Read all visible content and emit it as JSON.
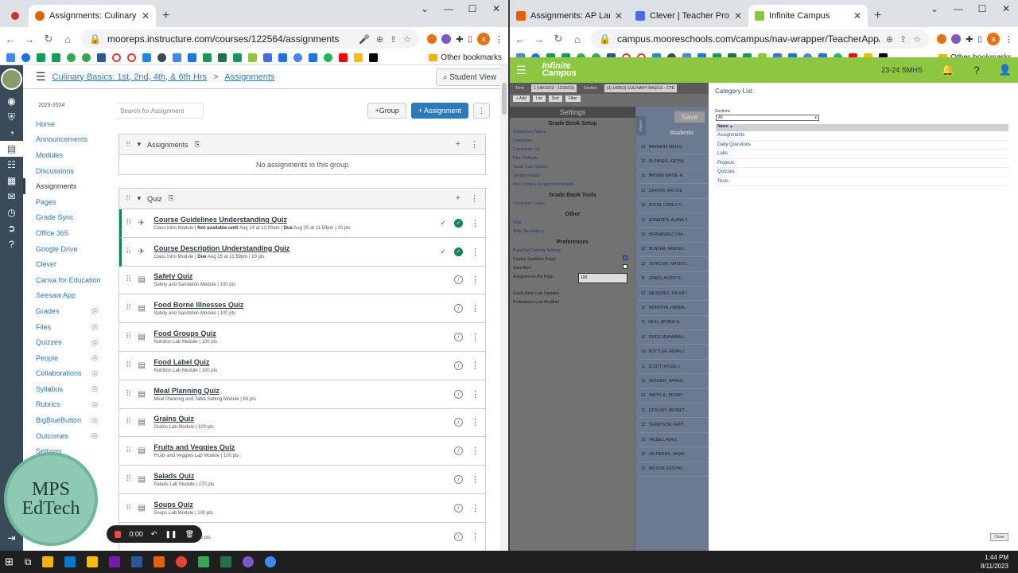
{
  "left_browser": {
    "tabs": [
      {
        "title": "Assignments: Culinary Basics: 1st,",
        "active": true
      }
    ],
    "url": "mooreps.instructure.com/courses/122564/assignments",
    "other_bookmarks": "Other bookmarks",
    "profile_initial": "a"
  },
  "canvas": {
    "breadcrumb_course": "Culinary Basics: 1st, 2nd, 4th, & 6th Hrs",
    "breadcrumb_sep": ">",
    "breadcrumb_page": "Assignments",
    "student_view": "Student View",
    "year": "2023-2024",
    "nav": [
      {
        "label": "Home",
        "active": false,
        "hidden": false
      },
      {
        "label": "Announcements",
        "active": false,
        "hidden": false
      },
      {
        "label": "Modules",
        "active": false,
        "hidden": false
      },
      {
        "label": "Discussions",
        "active": false,
        "hidden": false
      },
      {
        "label": "Assignments",
        "active": true,
        "hidden": false
      },
      {
        "label": "Pages",
        "active": false,
        "hidden": false
      },
      {
        "label": "Grade Sync",
        "active": false,
        "hidden": false
      },
      {
        "label": "Office 365",
        "active": false,
        "hidden": false
      },
      {
        "label": "Google Drive",
        "active": false,
        "hidden": false
      },
      {
        "label": "Clever",
        "active": false,
        "hidden": false
      },
      {
        "label": "Canva for Education",
        "active": false,
        "hidden": false
      },
      {
        "label": "Seesaw App",
        "active": false,
        "hidden": false
      },
      {
        "label": "Grades",
        "active": false,
        "hidden": true
      },
      {
        "label": "Files",
        "active": false,
        "hidden": true
      },
      {
        "label": "Quizzes",
        "active": false,
        "hidden": true
      },
      {
        "label": "People",
        "active": false,
        "hidden": true
      },
      {
        "label": "Collaborations",
        "active": false,
        "hidden": true
      },
      {
        "label": "Syllabus",
        "active": false,
        "hidden": true
      },
      {
        "label": "Rubrics",
        "active": false,
        "hidden": true
      },
      {
        "label": "BigBlueButton",
        "active": false,
        "hidden": true
      },
      {
        "label": "Outcomes",
        "active": false,
        "hidden": true
      },
      {
        "label": "Settings",
        "active": false,
        "hidden": false
      }
    ],
    "search_placeholder": "Search for Assignment",
    "group_button": "+Group",
    "assignment_button": "+ Assignment",
    "assignments_group": {
      "name": "Assignments",
      "empty": "No assignments in this group"
    },
    "quiz_group": {
      "name": "Quiz",
      "items": [
        {
          "name": "Course Guidelines Understanding Quiz",
          "module": "Class Intro Module",
          "availability": "Not available until",
          "availability_date": "Aug 14 at 12:00am",
          "due_label": "Due",
          "due": "Aug 25 at 11:59pm",
          "points": "10 pts",
          "published": true
        },
        {
          "name": "Course Description Understanding Quiz",
          "module": "Class Intro Module",
          "availability": "",
          "availability_date": "",
          "due_label": "Due",
          "due": "Aug 25 at 11:59pm",
          "points": "10 pts",
          "published": true
        },
        {
          "name": "Safety Quiz",
          "module": "Safety and Sanitation Module",
          "points": "100 pts",
          "published": false
        },
        {
          "name": "Food Borne Illnesses Quiz",
          "module": "Safety and Sanitation Module",
          "points": "100 pts",
          "published": false
        },
        {
          "name": "Food Groups Quiz",
          "module": "Nutrition Lab Module",
          "points": "100 pts",
          "published": false
        },
        {
          "name": "Food Label Quiz",
          "module": "Nutrition Lab Module",
          "points": "100 pts",
          "published": false
        },
        {
          "name": "Meal Planning Quiz",
          "module": "Meal Planning and Table Setting Module",
          "points": "60 pts",
          "published": false
        },
        {
          "name": "Grains Quiz",
          "module": "Grains Lab Module",
          "points": "100 pts",
          "published": false
        },
        {
          "name": "Fruits and Veggies Quiz",
          "module": "Fruits and Veggies Lab Module",
          "points": "100 pts",
          "published": false
        },
        {
          "name": "Salads Quiz",
          "module": "Salads Lab Module",
          "points": "170 pts",
          "published": false
        },
        {
          "name": "Soups Quiz",
          "module": "Soups Lab Module",
          "points": "100 pts",
          "published": false
        },
        {
          "name": "",
          "module": "Dairy Lab Module",
          "points": "125 pts",
          "published": false
        }
      ]
    },
    "watermark": [
      "MPS",
      "EdTech"
    ],
    "recorder_time": "0:00"
  },
  "right_browser": {
    "tabs": [
      {
        "title": "Assignments: AP Language and",
        "active": false,
        "color": "#e66000"
      },
      {
        "title": "Clever | Teacher Profile",
        "active": false,
        "color": "#436cf2"
      },
      {
        "title": "Infinite Campus",
        "active": true,
        "color": "#8dc63f"
      }
    ],
    "url": "campus.mooreschools.com/campus/nav-wrapper/TeacherApp/control-cente...",
    "other_bookmarks": "Other bookmarks",
    "profile_initial": "a"
  },
  "ic": {
    "logo_line1": "Infinite",
    "logo_line2": "Campus",
    "school": "23-24 SMHS",
    "term": "Term",
    "term_value": "1 (08/10/23 - 12/20/23)",
    "section_label": "Section",
    "section_value": "(3) 1405(3) CULINARY BASICS - CTE",
    "tool_buttons": [
      "+ Add",
      "List",
      "Sort",
      "Filter"
    ],
    "settings_title": "Settings",
    "save_label": "Save",
    "students_label": "Students",
    "settings_tab": "Settings",
    "sections": [
      {
        "title": "Grade Book Setup",
        "items": [
          "Assignment Marks",
          "Categories",
          "Curriculum List",
          "Filter Defaults",
          "Grade Calc Options",
          "Section Groups",
          "Non-Campus Assignment Defaults"
        ]
      },
      {
        "title": "Grade Book Tools",
        "items": [
          "Curriculum Copier"
        ]
      },
      {
        "title": "Other",
        "items": [
          "Help",
          "Web Site Address"
        ]
      }
    ],
    "preferences_title": "Preferences",
    "preferences": {
      "pass_fail": "Pass/Fail Coloring Settings",
      "sparkline": "Display Sparkline Graph",
      "save_alert": "Save Alert",
      "per_page": "Assignments Per Page",
      "per_page_value": "100",
      "last_updated": "Grade Book Last Updated",
      "last_modified": "Preferences Last Modified"
    },
    "students": [
      {
        "grade": "12",
        "name": "BARRERA MATEO"
      },
      {
        "grade": "12",
        "name": "BLONNER, KEONA"
      },
      {
        "grade": "10",
        "name": "BROWN WHITE, R."
      },
      {
        "grade": "12",
        "name": "CARTER, KAYLEE"
      },
      {
        "grade": "12",
        "name": "DIXON, CRISLY C."
      },
      {
        "grade": "12",
        "name": "EDWARDS, ALANA C."
      },
      {
        "grade": "12",
        "name": "HERNANDEZ CHA.."
      },
      {
        "grade": "12",
        "name": "HUNTER, MADISO.."
      },
      {
        "grade": "12",
        "name": "JEFFCOAT, MATEO L."
      },
      {
        "grade": "11",
        "name": "JONES, AVERY R."
      },
      {
        "grade": "12",
        "name": "MEISSNER, KALEB I."
      },
      {
        "grade": "12",
        "name": "MONTOYA, HANNA.."
      },
      {
        "grade": "11",
        "name": "NEAL, ARIANA G."
      },
      {
        "grade": "12",
        "name": "PRICE MUHAMMA.."
      },
      {
        "grade": "10",
        "name": "ROTTLER, AIDAN J."
      },
      {
        "grade": "11",
        "name": "SCOTT, RYLEE J."
      },
      {
        "grade": "12",
        "name": "SKINNER, HANNA.."
      },
      {
        "grade": "12",
        "name": "SMITH Jr., DEWAY.."
      },
      {
        "grade": "12",
        "name": "STOLSBY, KENNET.."
      },
      {
        "grade": "12",
        "name": "TENNYSON, NATH.."
      },
      {
        "grade": "12",
        "name": "VALDEZ, AVA E."
      },
      {
        "grade": "12",
        "name": "VALTIERRA, YASMI.."
      },
      {
        "grade": "12",
        "name": "WILSON, ESSYNC.."
      }
    ],
    "category_list_title": "Category List",
    "sections_label": "Sections",
    "sections_select": "All",
    "name_header": "Name ▲",
    "categories": [
      "Assignments",
      "Daily Questions",
      "Labs",
      "Projects",
      "Quizzes",
      "Tests"
    ],
    "close_label": "Close"
  },
  "taskbar": {
    "time": "1:44 PM",
    "date": "8/11/2023"
  }
}
